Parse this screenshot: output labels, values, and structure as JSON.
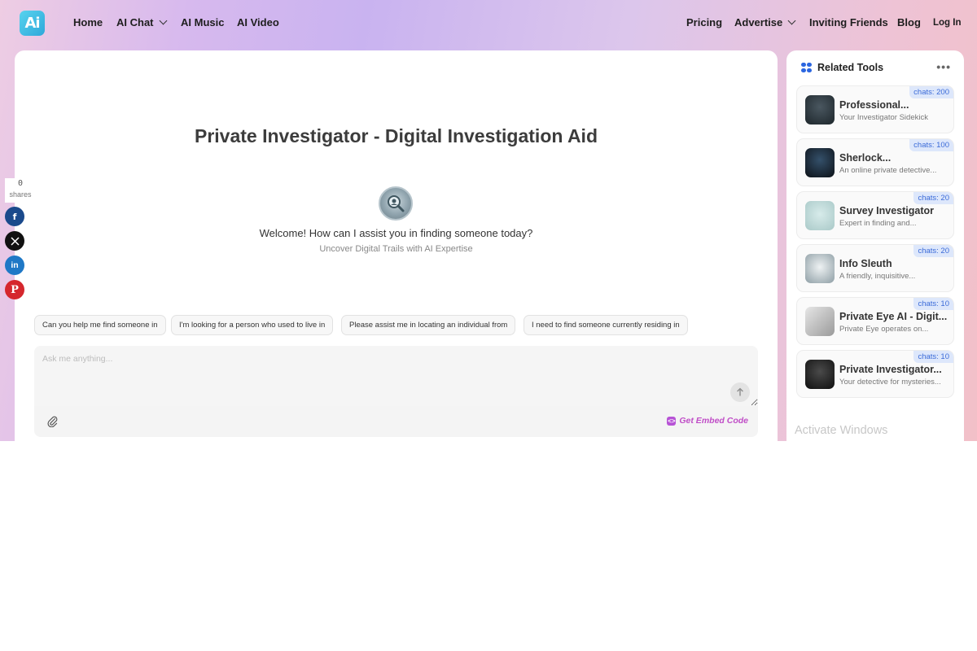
{
  "header": {
    "logo_text": "Ai",
    "nav_left": [
      "Home",
      "AI Chat",
      "AI Music",
      "AI Video"
    ],
    "nav_right": [
      "Pricing",
      "Advertise",
      "Inviting Friends",
      "Blog",
      "Log In"
    ]
  },
  "main": {
    "title": "Private Investigator - Digital Investigation Aid",
    "welcome": "Welcome! How can I assist you in finding someone today?",
    "tagline": "Uncover Digital Trails with AI Expertise",
    "suggestions": [
      "Can you help me find someone in",
      "I'm looking for a person who used to live in",
      "Please assist me in locating an individual from",
      "I need to find someone currently residing in"
    ],
    "input_placeholder": "Ask me anything...",
    "embed_label": "Get Embed Code"
  },
  "share": {
    "count": "0",
    "label": "shares",
    "colors": {
      "facebook": "#1a4a8c",
      "x": "#111111",
      "linkedin": "#1f78c6",
      "pinterest": "#d5272d"
    }
  },
  "sidebar": {
    "title": "Related Tools",
    "tools": [
      {
        "name": "Professional...",
        "desc": "Your Investigator Sidekick",
        "badge": "chats: 200"
      },
      {
        "name": "Sherlock...",
        "desc": "An online private detective...",
        "badge": "chats: 100"
      },
      {
        "name": "Survey Investigator",
        "desc": "Expert in finding and...",
        "badge": "chats: 20"
      },
      {
        "name": "Info Sleuth",
        "desc": "A friendly, inquisitive...",
        "badge": "chats: 20"
      },
      {
        "name": "Private Eye AI - Digit...",
        "desc": "Private Eye operates on...",
        "badge": "chats: 10"
      },
      {
        "name": "Private Investigator...",
        "desc": "Your detective for mysteries...",
        "badge": "chats: 10"
      }
    ]
  },
  "watermark": "Activate Windows"
}
